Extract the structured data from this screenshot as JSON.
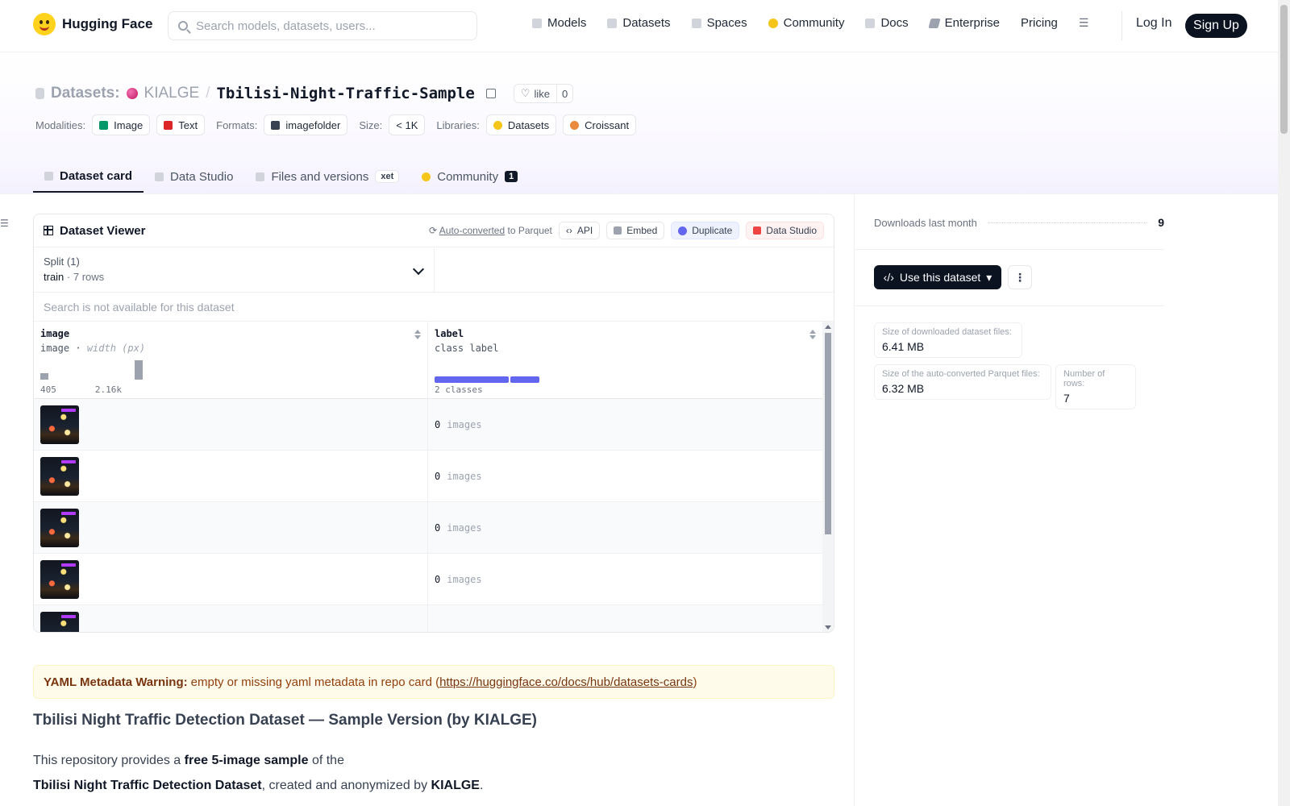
{
  "header": {
    "brand": "Hugging Face",
    "search_placeholder": "Search models, datasets, users...",
    "nav": [
      "Models",
      "Datasets",
      "Spaces",
      "Community",
      "Docs",
      "Enterprise",
      "Pricing"
    ],
    "login": "Log In",
    "signup": "Sign Up"
  },
  "repo": {
    "type_label": "Datasets:",
    "org": "KIALGE",
    "name": "Tbilisi-Night-Traffic-Sample",
    "like_label": "like",
    "like_count": "0"
  },
  "tags": {
    "modalities_label": "Modalities:",
    "modalities": [
      "Image",
      "Text"
    ],
    "formats_label": "Formats:",
    "format": "imagefolder",
    "size_label": "Size:",
    "size": "< 1K",
    "libraries_label": "Libraries:",
    "libraries": [
      "Datasets",
      "Croissant"
    ]
  },
  "tabs": {
    "card": "Dataset card",
    "studio": "Data Studio",
    "files": "Files and versions",
    "xet": "xet",
    "community": "Community",
    "community_count": "1"
  },
  "viewer": {
    "title": "Dataset Viewer",
    "auto_converted": "Auto-converted",
    "to_parquet": "to Parquet",
    "api": "API",
    "embed": "Embed",
    "duplicate": "Duplicate",
    "data_studio": "Data Studio",
    "split_label": "Split (1)",
    "split_name": "train",
    "split_rows": "7 rows",
    "search_na": "Search is not available for this dataset",
    "columns": [
      {
        "name": "image",
        "type": "image",
        "subtype": "width (px)",
        "min": "405",
        "max": "2.16k"
      },
      {
        "name": "label",
        "type": "class label",
        "classes": "2 classes"
      }
    ],
    "rows": [
      {
        "label_idx": "0",
        "label_name": "images"
      },
      {
        "label_idx": "0",
        "label_name": "images"
      },
      {
        "label_idx": "0",
        "label_name": "images"
      },
      {
        "label_idx": "0",
        "label_name": "images"
      }
    ]
  },
  "warning": {
    "title": "YAML Metadata Warning:",
    "text": "empty or missing yaml metadata in repo card (",
    "link": "https://huggingface.co/docs/hub/datasets-cards",
    "close": ")"
  },
  "card": {
    "heading": "Tbilisi Night Traffic Detection Dataset — Sample Version (by KIALGE)",
    "p1_a": "This repository provides a ",
    "p1_b": "free 5-image sample",
    "p1_c": " of the",
    "p2_a": "Tbilisi Night Traffic Detection Dataset",
    "p2_b": ", created and anonymized by ",
    "p2_c": "KIALGE",
    "p2_d": "."
  },
  "side": {
    "downloads_label": "Downloads last month",
    "downloads": "9",
    "use_button": "Use this dataset",
    "size_dl_label": "Size of downloaded dataset files:",
    "size_dl": "6.41 MB",
    "size_pq_label": "Size of the auto-converted Parquet files:",
    "size_pq": "6.32 MB",
    "rows_label": "Number of rows:",
    "rows": "7"
  },
  "colors": {
    "accent": "#6366f1",
    "dark": "#0b1220",
    "warning_bg": "#fffbeb"
  }
}
